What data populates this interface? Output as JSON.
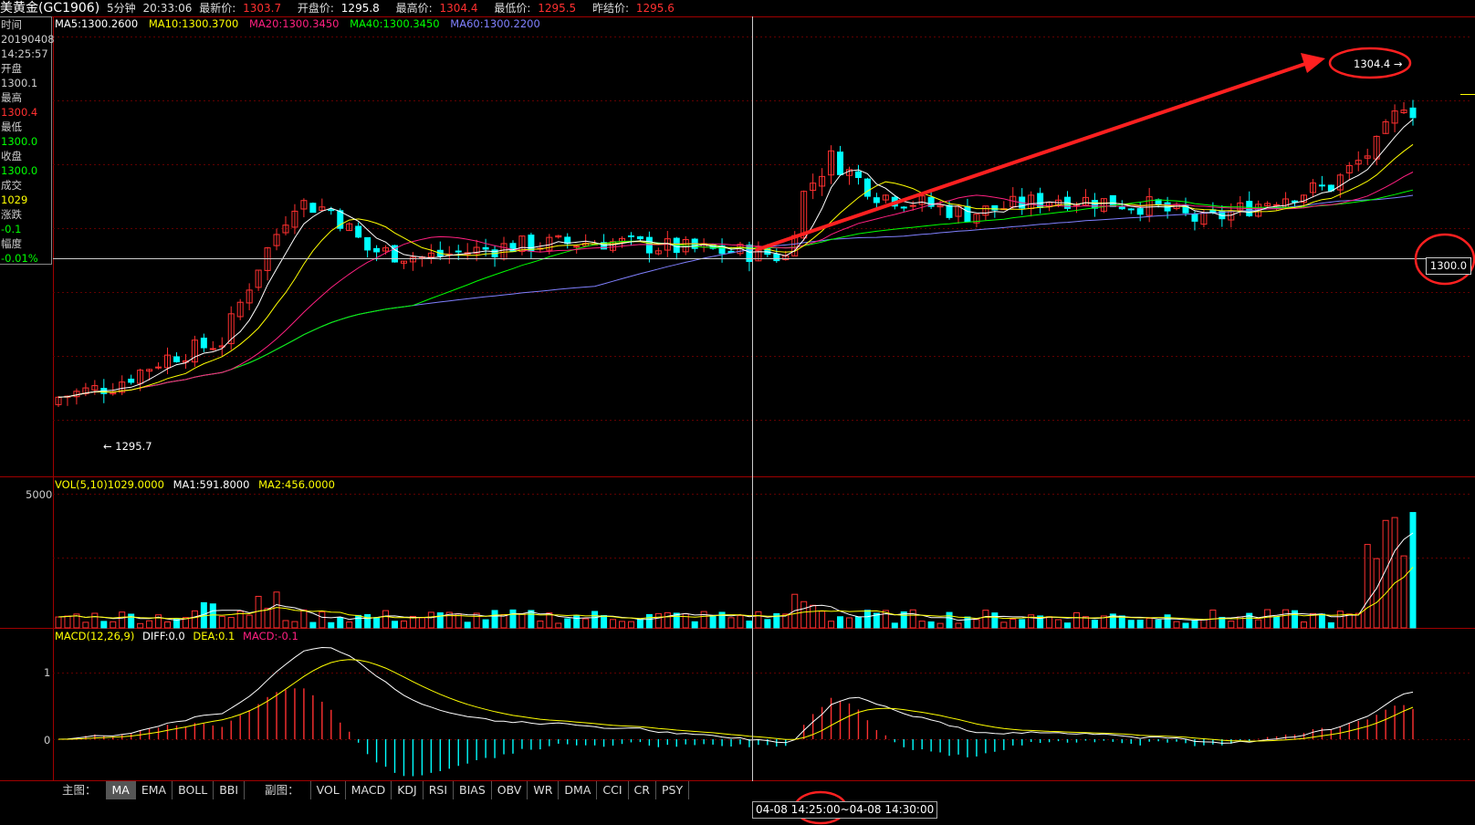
{
  "header": {
    "title": "美黄金(GC1906)",
    "period": "5分钟",
    "time": "20:33:06",
    "latest_label": "最新价:",
    "latest": "1303.7",
    "open_label": "开盘价:",
    "open": "1295.8",
    "high_label": "最高价:",
    "high": "1304.4",
    "low_label": "最低价:",
    "low": "1295.5",
    "prev_label": "昨结价:",
    "prev": "1295.6"
  },
  "info_panel": {
    "time_label": "时间",
    "date": "20190408",
    "time": "14:25:57",
    "open_label": "开盘",
    "open": "1300.1",
    "high_label": "最高",
    "high": "1300.4",
    "low_label": "最低",
    "low": "1300.0",
    "close_label": "收盘",
    "close": "1300.0",
    "volume_label": "成交",
    "volume": "1029",
    "change_label": "涨跌",
    "change": "-0.1",
    "pct_label": "幅度",
    "pct": "-0.01%"
  },
  "ma_legend": {
    "ma5": "MA5:1300.2600",
    "ma10": "MA10:1300.3700",
    "ma20": "MA20:1300.3450",
    "ma40": "MA40:1300.3450",
    "ma60": "MA60:1300.2200"
  },
  "vol_legend": {
    "vol": "VOL(5,10)1029.0000",
    "ma1": "MA1:591.8000",
    "ma2": "MA2:456.0000"
  },
  "macd_legend": {
    "name": "MACD(12,26,9)",
    "diff": "DIFF:0.0",
    "dea": "DEA:0.1",
    "macd": "MACD:-0.1"
  },
  "axes": {
    "vol_5000": "5000",
    "macd_1": "1",
    "macd_0": "0"
  },
  "annotations": {
    "high_marker": "1304.4",
    "low_marker": "1295.7",
    "crosshair_price": "1300.0",
    "crosshair_time": "04-08 14:25:00~04-08 14:30:00"
  },
  "bottom_tabs": {
    "main_label": "主图：",
    "main": [
      "MA",
      "EMA",
      "BOLL",
      "BBI"
    ],
    "active_main": "MA",
    "sub_label": "副图：",
    "sub": [
      "VOL",
      "MACD",
      "KDJ",
      "RSI",
      "BIAS",
      "OBV",
      "WR",
      "DMA",
      "CCI",
      "CR",
      "PSY"
    ]
  },
  "colors": {
    "up": "#ff3030",
    "down": "#00ffff",
    "ma5": "#ffffff",
    "ma10": "#ffff00",
    "ma20": "#ff2080",
    "ma40": "#00ff00",
    "ma60": "#8080ff"
  }
}
